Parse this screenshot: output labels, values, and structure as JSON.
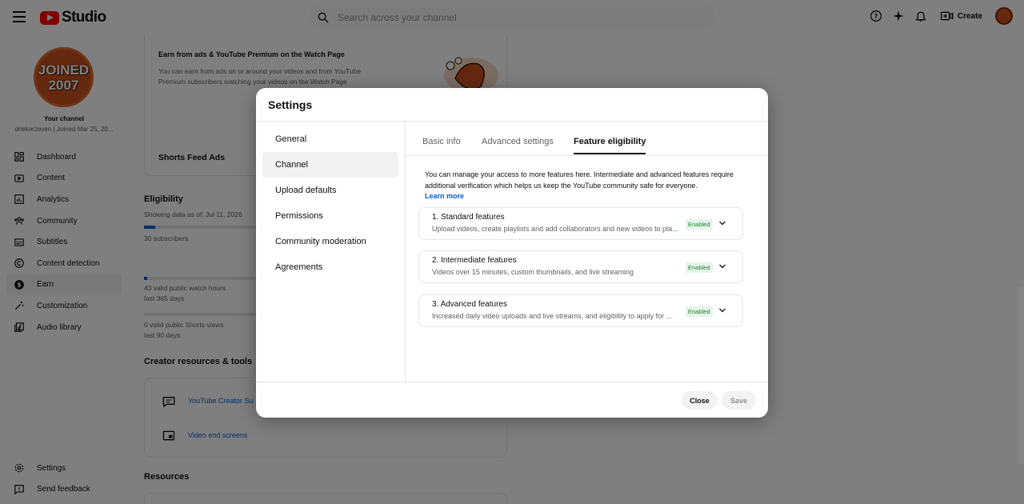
{
  "app": {
    "title": "Studio",
    "search_placeholder": "Search across your channel",
    "create_label": "Create"
  },
  "sidebar": {
    "avatar_text_1": "JOINED",
    "avatar_text_2": "2007",
    "channel_label": "Your channel",
    "channel_name": "driekerzeven | Joined Mar 25, 20...",
    "items": [
      {
        "label": "Dashboard",
        "icon": "dashboard-icon"
      },
      {
        "label": "Content",
        "icon": "content-icon"
      },
      {
        "label": "Analytics",
        "icon": "analytics-icon"
      },
      {
        "label": "Community",
        "icon": "community-icon"
      },
      {
        "label": "Subtitles",
        "icon": "subtitles-icon"
      },
      {
        "label": "Content detection",
        "icon": "copyright-icon"
      },
      {
        "label": "Earn",
        "icon": "dollar-icon"
      },
      {
        "label": "Customization",
        "icon": "magic-wand-icon"
      },
      {
        "label": "Audio library",
        "icon": "audio-library-icon"
      }
    ],
    "bottom_items": [
      {
        "label": "Settings",
        "icon": "gear-icon"
      },
      {
        "label": "Send feedback",
        "icon": "feedback-icon"
      }
    ]
  },
  "background": {
    "earn_title": "Earn from ads & YouTube Premium on the Watch Page",
    "earn_desc_1": "You can earn from ads on or around your videos and from YouTube",
    "earn_desc_2": "Premium subscribers watching your videos on the Watch Page",
    "shorts_ads": "Shorts Feed Ads",
    "eligibility_heading": "Eligibility",
    "showing_data": "Showing data as of: Jul 11, 2026",
    "subscribers": "30 subscribers",
    "watch_hours": "43 valid public watch hours",
    "watch_hours_period": "last 365 days",
    "shorts_views": "0 valid public Shorts views",
    "shorts_views_period": "last 90 days",
    "resources_tools_heading": "Creator resources & tools",
    "creator_support": "YouTube Creator Su",
    "end_screens": "Video end screens",
    "resources_heading": "Resources",
    "subscribers_progress": 0.1,
    "watch_hours_progress": 0.01,
    "shorts_views_progress": 0
  },
  "dialog": {
    "title": "Settings",
    "nav": [
      "General",
      "Channel",
      "Upload defaults",
      "Permissions",
      "Community moderation",
      "Agreements"
    ],
    "active_nav": "Channel",
    "tabs": [
      "Basic info",
      "Advanced settings",
      "Feature eligibility"
    ],
    "active_tab": "Feature eligibility",
    "intro": "You can manage your access to more features here. Intermediate and advanced features require additional verification which helps us keep the YouTube community safe for everyone.",
    "learn_more": "Learn more",
    "features": [
      {
        "title": "1. Standard features",
        "desc": "Upload videos, create playlists and add collaborators and new videos to pla...",
        "status": "Enabled"
      },
      {
        "title": "2. Intermediate features",
        "desc": "Videos over 15 minutes, custom thumbnails, and live streaming",
        "status": "Enabled"
      },
      {
        "title": "3. Advanced features",
        "desc": "Increased daily video uploads and live streams, and eligibility to apply for ...",
        "status": "Enabled"
      }
    ],
    "close_label": "Close",
    "save_label": "Save"
  },
  "colors": {
    "accent_link": "#065fd4",
    "enabled_badge_text": "#1e7e34",
    "enabled_badge_bg": "#e6f4ea",
    "brand_red": "#ff0000"
  }
}
